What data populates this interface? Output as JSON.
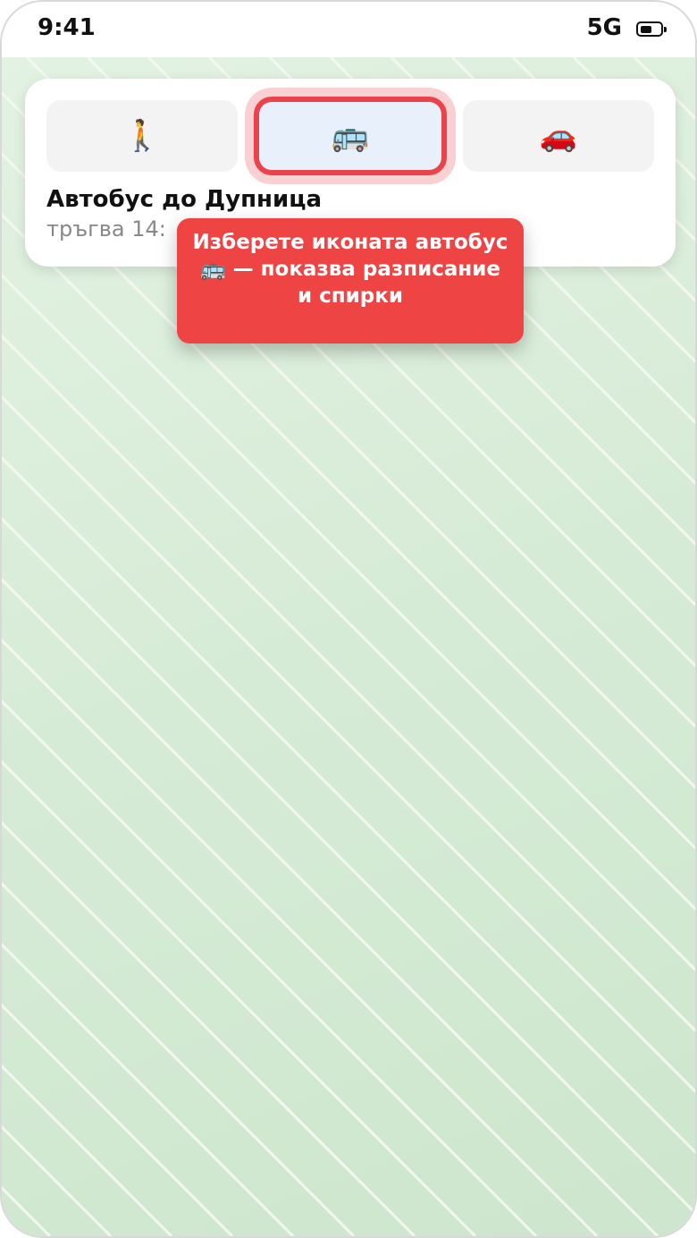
{
  "status_bar": {
    "time": "9:41",
    "network": "5G",
    "battery_level": 0.65
  },
  "transport_modes": [
    {
      "name": "walk",
      "icon": "🚶",
      "selected": false
    },
    {
      "name": "bus",
      "icon": "🚌",
      "selected": true
    },
    {
      "name": "car",
      "icon": "🚗",
      "selected": false
    }
  ],
  "route": {
    "title": "Автобус до Дупница",
    "subtitle": "тръгва 14:"
  },
  "tooltip": {
    "text": "Изберете иконата автобус 🚌 — показва разписание и спирки"
  },
  "colors": {
    "highlight": "#ea444a",
    "tooltip_bg": "#ef4444",
    "map_bg": "#d6ebd6"
  }
}
